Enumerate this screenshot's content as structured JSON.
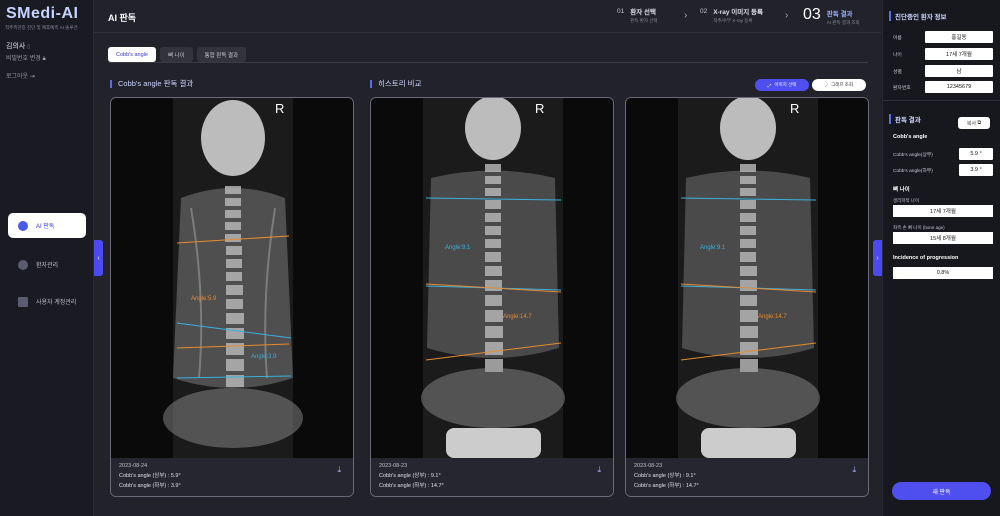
{
  "brand": {
    "logo": "SMedi-AI",
    "tagline": "척추측만증 진단 및 예후예측 AI 솔루션"
  },
  "user": {
    "name": "김의사",
    "password_change": "비밀번호 변경",
    "logout": "로그아웃"
  },
  "nav": [
    {
      "label": "AI 판독",
      "active": true
    },
    {
      "label": "환자관리",
      "active": false
    },
    {
      "label": "사용자 계정관리",
      "active": false
    }
  ],
  "page_title": "AI 판독",
  "steps": [
    {
      "num": "01",
      "title": "환자 선택",
      "sub": "판독 환자 선택"
    },
    {
      "num": "02",
      "title": "X-ray 이미지 등록",
      "sub": "척추/수부 X-ray 등록"
    },
    {
      "num": "03",
      "title": "판독 결과",
      "sub": "AI 판독 결과 조회"
    }
  ],
  "tabs": [
    "Cobb's angle",
    "뼈 나이",
    "통합 판독 결과"
  ],
  "section_result": "Cobb's angle 판독 결과",
  "section_history": "히스토리 비교",
  "btn_image_select": "이미지 선택",
  "btn_graph": "그래프 조회",
  "cards": [
    {
      "date": "2023-08-24",
      "upper": "Cobb's angle (상부) : 5.9°",
      "lower": "Cobb's angle (하부) : 3.9°",
      "angle_a": "Angle:5.9",
      "angle_b": "Angle:3.9"
    },
    {
      "date": "2023-08-23",
      "upper": "Cobb's angle (상부) : 9.1°",
      "lower": "Cobb's angle (하부) : 14.7°",
      "angle_a": "Angle:9.1",
      "angle_b": "Angle:14.7"
    },
    {
      "date": "2023-08-23",
      "upper": "Cobb's angle (상부) : 9.1°",
      "lower": "Cobb's angle (하부) : 14.7°",
      "angle_a": "Angle:9.1",
      "angle_b": "Angle:14.7"
    }
  ],
  "r_mark": "R",
  "patient": {
    "title": "진단중인 환자 정보",
    "fields": [
      {
        "label": "이름",
        "value": "홍길동"
      },
      {
        "label": "나이",
        "value": "17세 7개월"
      },
      {
        "label": "성별",
        "value": "남"
      },
      {
        "label": "환자번호",
        "value": "12345679"
      }
    ]
  },
  "result": {
    "title": "판독 결과",
    "copy": "복사",
    "cobb_title": "Cobb's angle",
    "cobb": [
      {
        "label": "Cobb's angle(상부)",
        "value": "5.9 °"
      },
      {
        "label": "Cobb's angle(하부)",
        "value": "3.9 °"
      }
    ],
    "bone_title": "뼈 나이",
    "chrono_label": "생리학적 나이",
    "chrono_value": "17세 7개월",
    "bone_label": "좌측 손 뼈 나이 (bone age)",
    "bone_value": "15세 8개월",
    "prog_title": "Incidence of progression",
    "prog_value": "0.8%"
  },
  "new_reading": "새 판독"
}
